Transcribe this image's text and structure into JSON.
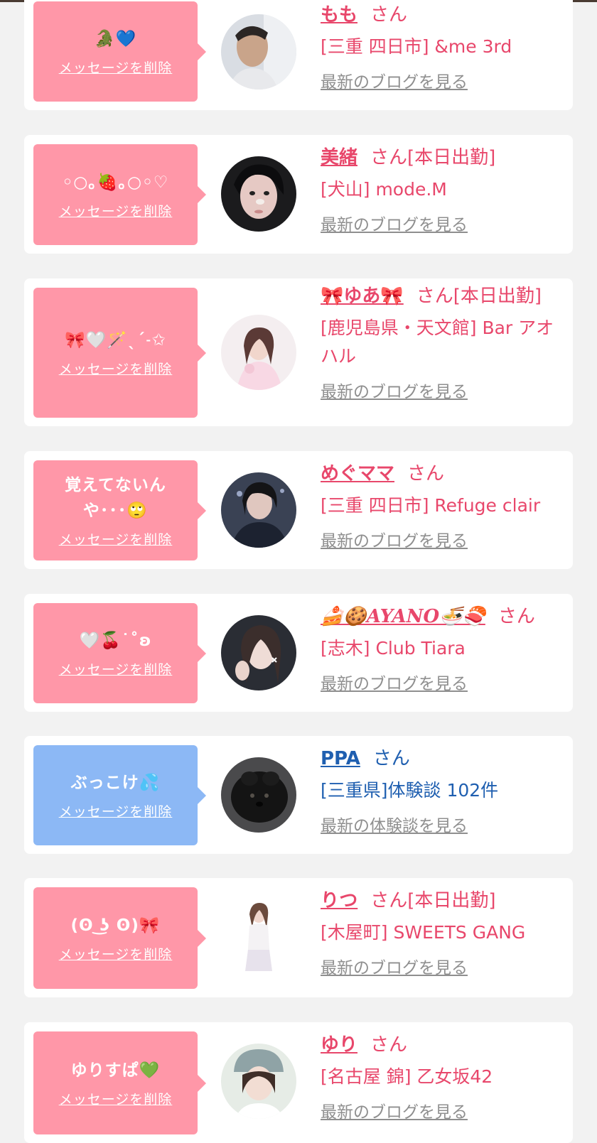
{
  "colors": {
    "pink_bubble": "#ff97a8",
    "blue_bubble": "#8cb8f5",
    "name_pink": "#e8476b",
    "name_blue": "#1f5fb0",
    "link_gray": "#8f8f8f",
    "page_bg": "#f2f2f2"
  },
  "items": [
    {
      "message": "🐊💙",
      "delete_label": "メッセージを削除",
      "name": "もも",
      "honorific": "さん",
      "status": "",
      "shop": "[三重 四日市] &me 3rd",
      "blog_link": "最新のブログを見る",
      "theme": "pink",
      "avatar": "man-portrait"
    },
    {
      "message": "◦○｡🍓｡○◦♡",
      "delete_label": "メッセージを削除",
      "name": "美緒",
      "honorific": "さん",
      "status": "[本日出勤]",
      "shop": "[犬山] mode.M",
      "blog_link": "最新のブログを見る",
      "theme": "pink",
      "avatar": "dark-hair-portrait"
    },
    {
      "message": "🎀🤍🪄ˎˊ˗✩",
      "delete_label": "メッセージを削除",
      "name": "🎀ゆあ🎀",
      "honorific": "さん",
      "status": "[本日出勤]",
      "shop": "[鹿児島県・天文館] Bar アオハル",
      "blog_link": "最新のブログを見る",
      "theme": "pink",
      "avatar": "light-portrait"
    },
    {
      "message": "覚えてないんや･･･🙄",
      "delete_label": "メッセージを削除",
      "name": "めぐママ",
      "honorific": "さん",
      "status": "",
      "shop": "[三重 四日市] Refuge clair",
      "blog_link": "最新のブログを見る",
      "theme": "pink",
      "avatar": "night-portrait"
    },
    {
      "message": "🤍🍒˙˚ʚ",
      "delete_label": "メッセージを削除",
      "name": "🍰🍪AYANO🍜🍣",
      "honorific": "さん",
      "status": "",
      "shop": "[志木] Club Tiara",
      "blog_link": "最新のブログを見る",
      "theme": "pink",
      "avatar": "selfie-portrait"
    },
    {
      "message": "ぶっこけ💦",
      "delete_label": "メッセージを削除",
      "name": "PPA",
      "honorific": "さん",
      "status": "",
      "shop": "[三重県]体験談 102件",
      "blog_link": "最新の体験談を見る",
      "theme": "blue",
      "avatar": "black-dog"
    },
    {
      "message": "(ʘ ͜ʖ ʘ)🎀",
      "delete_label": "メッセージを削除",
      "name": "りつ",
      "honorific": "さん",
      "status": "[本日出勤]",
      "shop": "[木屋町] SWEETS GANG",
      "blog_link": "最新のブログを見る",
      "theme": "pink",
      "avatar": "full-body"
    },
    {
      "message": "ゆりすぱ💚",
      "delete_label": "メッセージを削除",
      "name": "ゆり",
      "honorific": "さん",
      "status": "",
      "shop": "[名古屋 錦] 乙女坂42",
      "blog_link": "最新のブログを見る",
      "theme": "pink",
      "avatar": "hat-portrait"
    }
  ]
}
